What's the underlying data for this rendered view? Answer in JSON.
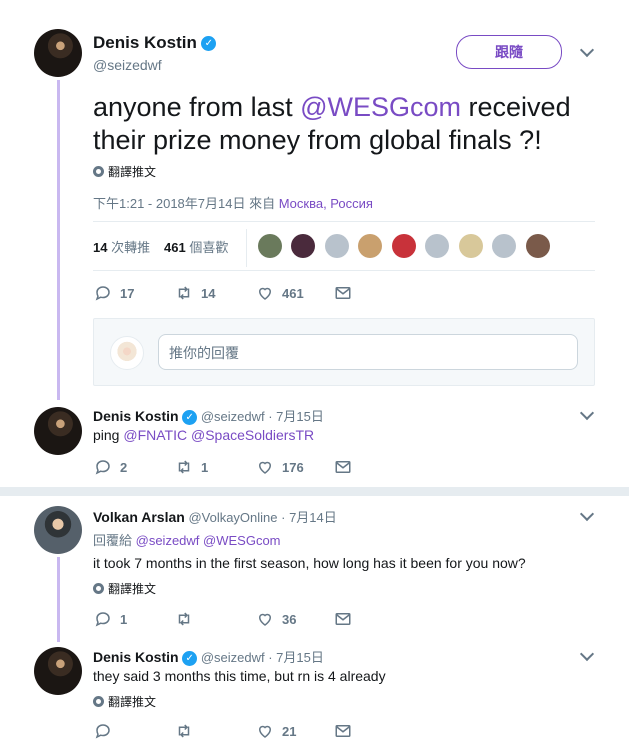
{
  "main_tweet": {
    "name": "Denis Kostin",
    "handle": "@seizedwf",
    "follow_label": "跟隨",
    "text_before": "anyone from last ",
    "mention": "@WESGcom",
    "text_after": " received their prize money from global finals ?!",
    "translate_label": "翻譯推文",
    "time": "下午1:21 - 2018年7月14日 來自 ",
    "location": "Москва, Россия",
    "retweets_count": "14",
    "retweets_label": "次轉推",
    "likes_count": "461",
    "likes_label": "個喜歡",
    "actions": {
      "replies": "17",
      "retweets": "14",
      "likes": "461"
    }
  },
  "reply_box": {
    "placeholder": "推你的回覆"
  },
  "reply1": {
    "name": "Denis Kostin",
    "handle": "@seizedwf",
    "date": "· 7月15日",
    "text_prefix": "ping ",
    "mention1": "@FNATIC",
    "mention2": "@SpaceSoldiersTR",
    "actions": {
      "replies": "2",
      "retweets": "1",
      "likes": "176"
    }
  },
  "reply2": {
    "name": "Volkan Arslan",
    "handle": "@VolkayOnline",
    "date": "· 7月14日",
    "replying_to_label": "回覆給 ",
    "replying_to_1": "@seizedwf",
    "replying_to_2": "@WESGcom",
    "text": "it took 7 months in the first season, how long has it been for you now?",
    "translate_label": "翻譯推文",
    "actions": {
      "replies": "1",
      "retweets": "",
      "likes": "36"
    }
  },
  "reply3": {
    "name": "Denis Kostin",
    "handle": "@seizedwf",
    "date": "· 7月15日",
    "text": "they said 3 months this time, but rn is 4 already",
    "translate_label": "翻譯推文",
    "actions": {
      "replies": "",
      "retweets": "",
      "likes": "21"
    }
  },
  "icons": {
    "verified": "verified-badge-icon",
    "reply": "reply-icon",
    "retweet": "retweet-icon",
    "like": "heart-icon",
    "dm": "envelope-icon",
    "more": "chevron-down-icon",
    "translate": "globe-icon"
  },
  "colors": {
    "accent": "#794bc4",
    "verified": "#1da1f2",
    "thread": "#c9b8f0",
    "muted": "#657786"
  }
}
